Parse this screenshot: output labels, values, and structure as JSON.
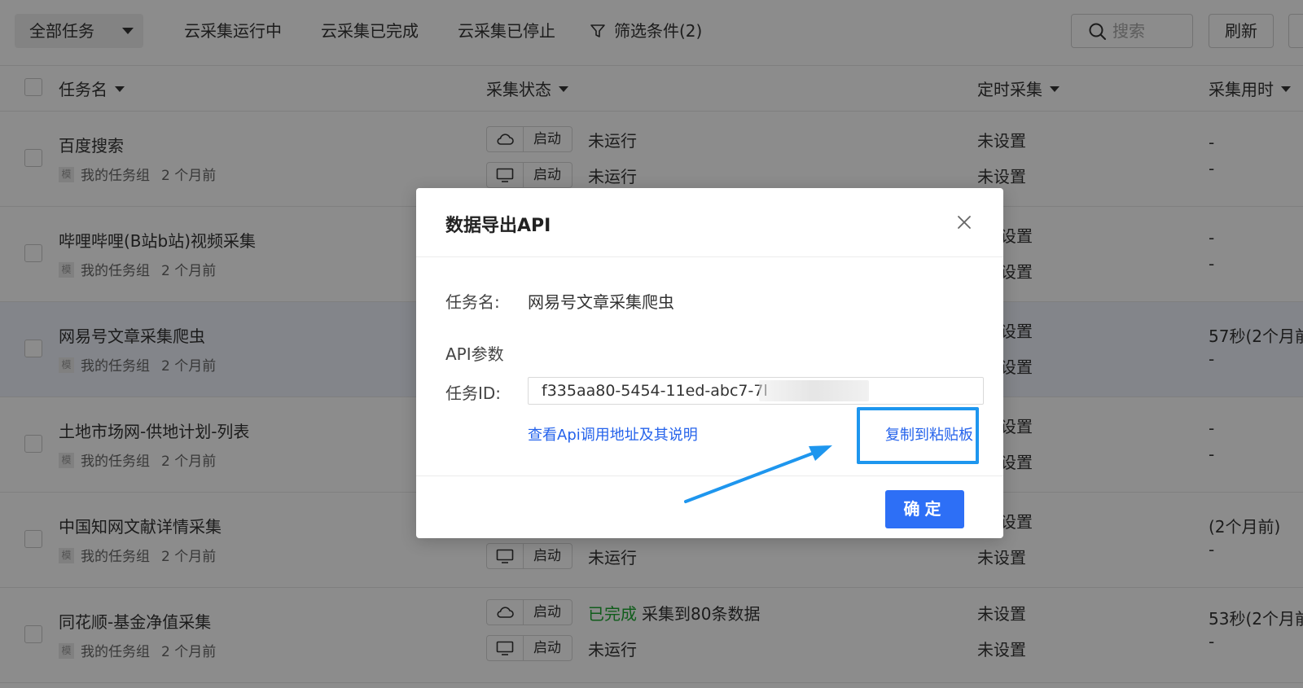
{
  "toolbar": {
    "dropdown_label": "全部任务",
    "tabs": [
      "云采集运行中",
      "云采集已完成",
      "云采集已停止"
    ],
    "filter_label": "筛选条件(2)",
    "search_placeholder": "搜索",
    "refresh_label": "刷新"
  },
  "table": {
    "columns": [
      "任务名",
      "采集状态",
      "定时采集",
      "采集用时"
    ],
    "start_label": "启动",
    "group_badge": "模",
    "rows": [
      {
        "name": "百度搜索",
        "group": "我的任务组",
        "time": "2 个月前",
        "cloud_status": "未运行",
        "local_status": "未运行",
        "sched1": "未设置",
        "sched2": "未设置",
        "time1": "-",
        "time2": "-"
      },
      {
        "name": "哔哩哔哩(B站b站)视频采集",
        "group": "我的任务组",
        "time": "2 个月前",
        "sched1": "设置",
        "sched2": "设置",
        "time1": "-",
        "time2": "-"
      },
      {
        "name": "网易号文章采集爬虫",
        "group": "我的任务组",
        "time": "2 个月前",
        "sched1": "设置",
        "sched2": "设置",
        "time1": "57秒(2个月前",
        "time2": "-"
      },
      {
        "name": "土地市场网-供地计划-列表",
        "group": "我的任务组",
        "time": "2 个月前",
        "sched1": "设置",
        "sched2": "设置",
        "time1": "-",
        "time2": "-"
      },
      {
        "name": "中国知网文献详情采集",
        "group": "我的任务组",
        "time": "2 个月前",
        "local_status": "未运行",
        "sched1": "设置",
        "sched2": "未设置",
        "time1": "(2个月前)",
        "time2": "-"
      },
      {
        "name": "同花顺-基金净值采集",
        "group": "我的任务组",
        "time": "2 个月前",
        "cloud_done": "已完成",
        "cloud_count": "采集到80条数据",
        "local_status": "未运行",
        "sched1": "未设置",
        "sched2": "未设置",
        "time1": "53秒(2个月前",
        "time2": "-"
      }
    ]
  },
  "modal": {
    "title": "数据导出API",
    "task_name_label": "任务名:",
    "task_name_value": "网易号文章采集爬虫",
    "api_section_label": "API参数",
    "task_id_label": "任务ID:",
    "task_id_value": "f335aa80-5454-11ed-abc7-7l",
    "api_doc_link": "查看Api调用地址及其说明",
    "copy_link": "复制到粘贴板",
    "ok_label": "确定"
  },
  "colors": {
    "accent": "#2d6ff6",
    "link": "#2563eb",
    "highlight": "#1e96ee",
    "done": "#1ea832"
  }
}
